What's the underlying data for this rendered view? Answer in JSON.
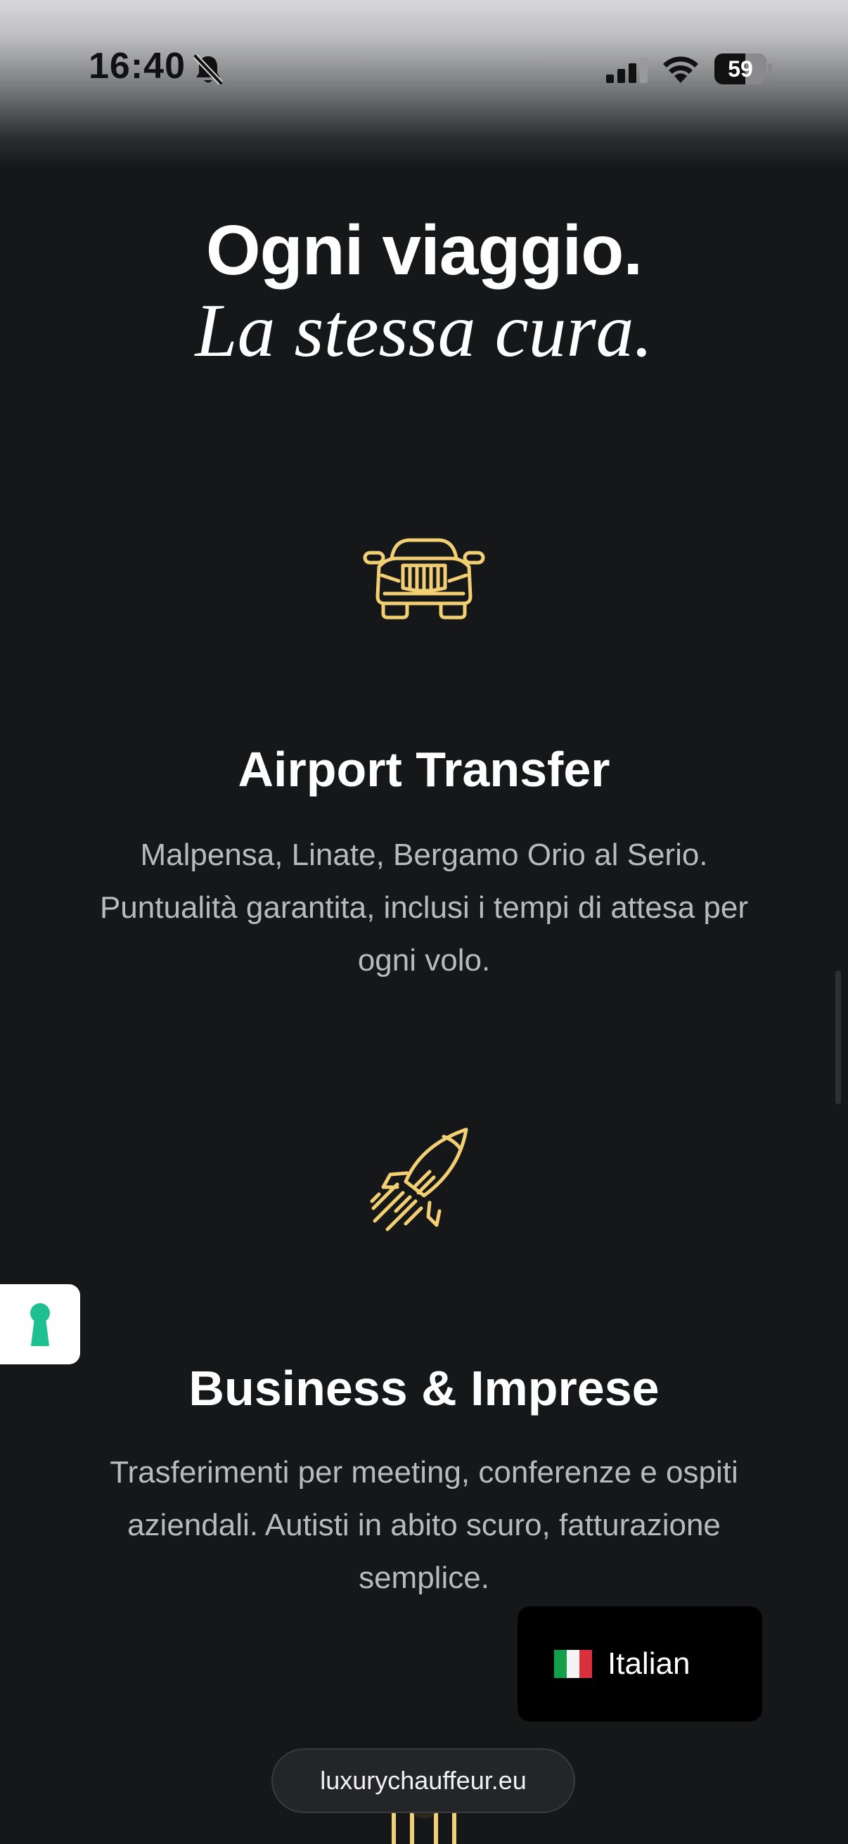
{
  "status_bar": {
    "time": "16:40",
    "battery_level": "59",
    "icons": [
      "bell-off-icon",
      "signal-icon",
      "wifi-icon",
      "battery-icon"
    ]
  },
  "heading": {
    "line1": "Ogni viaggio.",
    "line2": "La stessa cura."
  },
  "services": [
    {
      "icon": "car-icon",
      "title": "Airport Transfer",
      "description_lines": [
        "Malpensa, Linate, Bergamo Orio al Serio.",
        "Puntualità garantita, inclusi i tempi di attesa per",
        "ogni volo."
      ]
    },
    {
      "icon": "rocket-icon",
      "title": "Business & Imprese",
      "description_lines": [
        "Trasferimenti per meeting, conferenze e ospiti",
        "aziendali. Autisti in abito scuro, fatturazione",
        "semplice."
      ]
    }
  ],
  "side_tab": {
    "icon": "keyhole-icon"
  },
  "language_switcher": {
    "flag": "italy-flag-icon",
    "label": "Italian"
  },
  "url_bar": {
    "url": "luxurychauffeur.eu"
  },
  "colors": {
    "background": "#161719",
    "accent_gold": "#f1cf72",
    "keyhole_teal": "#1fc08f",
    "body_text": "#b9babc"
  }
}
